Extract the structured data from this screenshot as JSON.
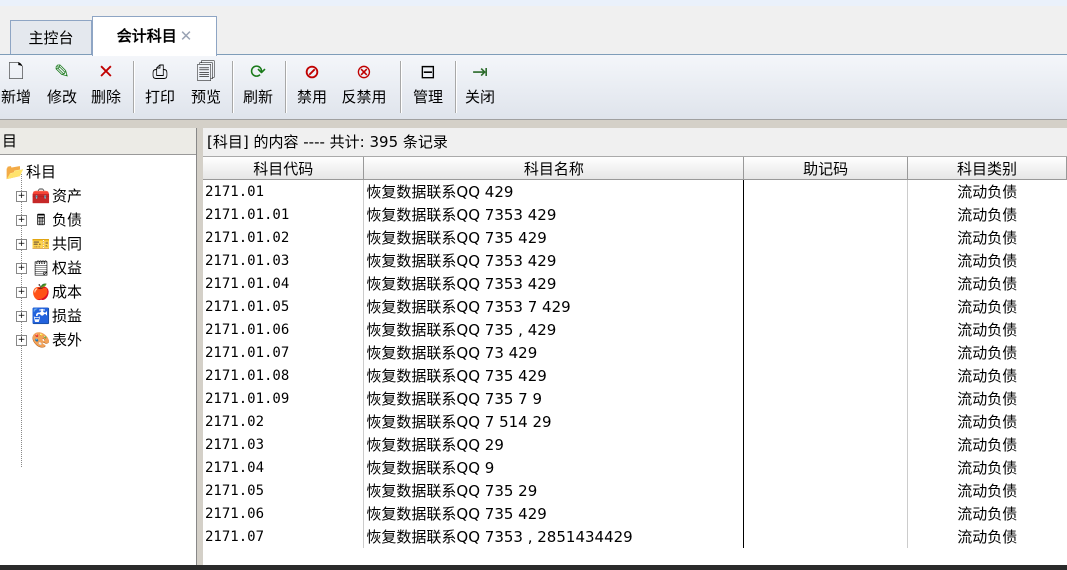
{
  "tabs": [
    {
      "label": "主控台"
    },
    {
      "label": "会计科目",
      "close": "✕"
    }
  ],
  "toolbar": {
    "new": "新增",
    "edit": "修改",
    "delete": "删除",
    "print": "打印",
    "preview": "预览",
    "refresh": "刷新",
    "disable": "禁用",
    "enable": "反禁用",
    "manage": "管理",
    "close": "关闭"
  },
  "tree": {
    "header": "目",
    "root": "科目",
    "items": [
      {
        "label": "资产",
        "icon": "assets-icon"
      },
      {
        "label": "负债",
        "icon": "liabilities-icon"
      },
      {
        "label": "共同",
        "icon": "common-icon"
      },
      {
        "label": "权益",
        "icon": "equity-icon"
      },
      {
        "label": "成本",
        "icon": "cost-icon"
      },
      {
        "label": "损益",
        "icon": "profit-loss-icon"
      },
      {
        "label": "表外",
        "icon": "off-balance-icon"
      }
    ]
  },
  "grid": {
    "caption": "[科目] 的内容 ---- 共计: 395 条记录",
    "columns": [
      "科目代码",
      "科目名称",
      "助记码",
      "科目类别"
    ],
    "rows": [
      {
        "code": "2171.01",
        "name": "恢复数据联系QQ                 429",
        "memo": "",
        "type": "流动负债"
      },
      {
        "code": "2171.01.01",
        "name": "恢复数据联系QQ 7353              429",
        "memo": "",
        "type": "流动负债"
      },
      {
        "code": "2171.01.02",
        "name": "恢复数据联系QQ 735               429",
        "memo": "",
        "type": "流动负债"
      },
      {
        "code": "2171.01.03",
        "name": "恢复数据联系QQ 7353              429",
        "memo": "",
        "type": "流动负债"
      },
      {
        "code": "2171.01.04",
        "name": "恢复数据联系QQ 7353              429",
        "memo": "",
        "type": "流动负债"
      },
      {
        "code": "2171.01.05",
        "name": "恢复数据联系QQ 7353   7          429",
        "memo": "",
        "type": "流动负债"
      },
      {
        "code": "2171.01.06",
        "name": "恢复数据联系QQ 735      ,        429",
        "memo": "",
        "type": "流动负债"
      },
      {
        "code": "2171.01.07",
        "name": "恢复数据联系QQ 73                429",
        "memo": "",
        "type": "流动负债"
      },
      {
        "code": "2171.01.08",
        "name": "恢复数据联系QQ 735               429",
        "memo": "",
        "type": "流动负债"
      },
      {
        "code": "2171.01.09",
        "name": "恢复数据联系QQ 735    7            9",
        "memo": "",
        "type": "流动负债"
      },
      {
        "code": "2171.02",
        "name": "恢复数据联系QQ 7           514    29",
        "memo": "",
        "type": "流动负债"
      },
      {
        "code": "2171.03",
        "name": "恢复数据联系QQ                    29",
        "memo": "",
        "type": "流动负债"
      },
      {
        "code": "2171.04",
        "name": "恢复数据联系QQ                     9",
        "memo": "",
        "type": "流动负债"
      },
      {
        "code": "2171.05",
        "name": "恢复数据联系QQ 735                29",
        "memo": "",
        "type": "流动负债"
      },
      {
        "code": "2171.06",
        "name": "恢复数据联系QQ 735               429",
        "memo": "",
        "type": "流动负债"
      },
      {
        "code": "2171.07",
        "name": "恢复数据联系QQ 7353     , 2851434429",
        "memo": "",
        "type": "流动负债"
      }
    ]
  }
}
